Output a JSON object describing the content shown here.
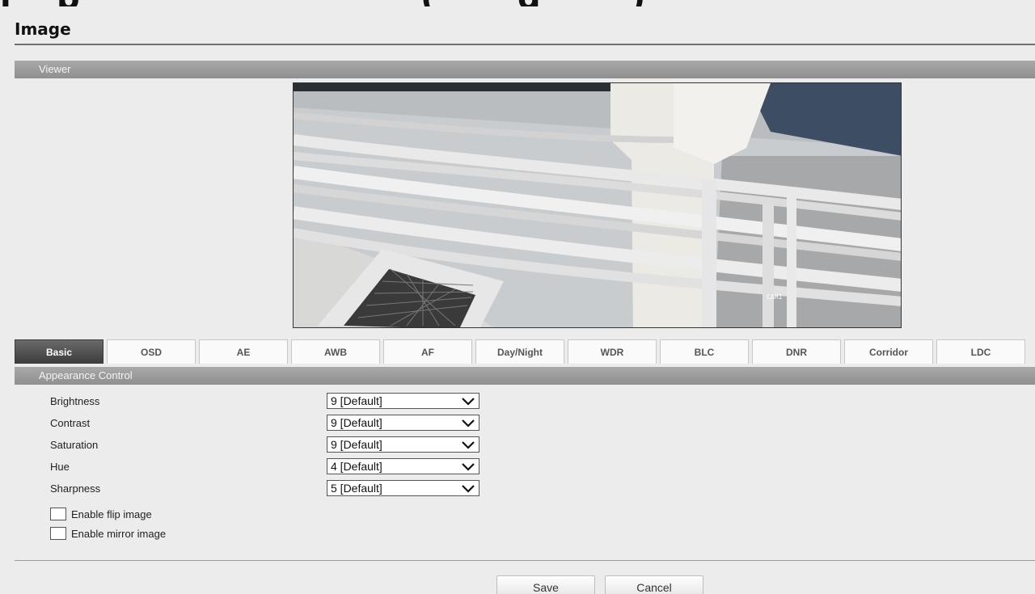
{
  "page": {
    "title": "Image"
  },
  "viewer_section": {
    "label": "Viewer",
    "camera_overlay": "CAM1"
  },
  "tabs": [
    {
      "label": "Basic",
      "active": true
    },
    {
      "label": "OSD",
      "active": false
    },
    {
      "label": "AE",
      "active": false
    },
    {
      "label": "AWB",
      "active": false
    },
    {
      "label": "AF",
      "active": false
    },
    {
      "label": "Day/Night",
      "active": false
    },
    {
      "label": "WDR",
      "active": false
    },
    {
      "label": "BLC",
      "active": false
    },
    {
      "label": "DNR",
      "active": false
    },
    {
      "label": "Corridor",
      "active": false
    },
    {
      "label": "LDC",
      "active": false
    }
  ],
  "appearance_section": {
    "label": "Appearance Control"
  },
  "settings": {
    "brightness": {
      "label": "Brightness",
      "value": "9 [Default]"
    },
    "contrast": {
      "label": "Contrast",
      "value": "9 [Default]"
    },
    "saturation": {
      "label": "Saturation",
      "value": "9 [Default]"
    },
    "hue": {
      "label": "Hue",
      "value": "4 [Default]"
    },
    "sharpness": {
      "label": "Sharpness",
      "value": "5 [Default]"
    }
  },
  "options": {
    "flip": {
      "label": "Enable flip image",
      "checked": false
    },
    "mirror": {
      "label": "Enable mirror image",
      "checked": false
    }
  },
  "actions": {
    "save_label": "Save",
    "cancel_label": "Cancel"
  },
  "colors": {
    "section_bar": "#9a9a9a",
    "active_tab": "#4a4a4a",
    "background": "#ececec"
  }
}
